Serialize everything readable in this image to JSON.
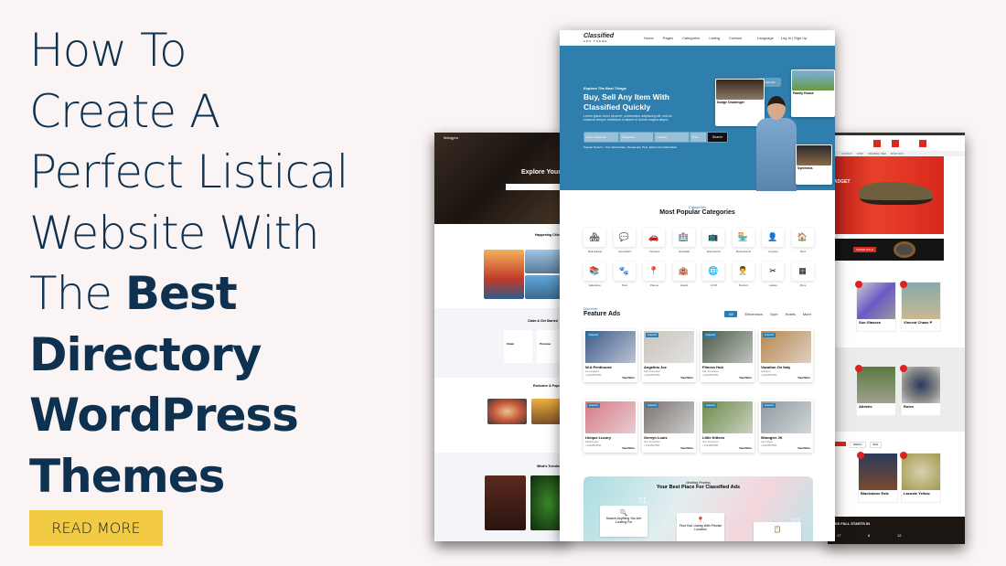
{
  "headline": {
    "lines_light": [
      "How To",
      "Create A",
      "Perfect Listical",
      "Website With"
    ],
    "line5_light": "The",
    "line5_bold": "Best",
    "lines_bold": [
      "Directory",
      "WordPress",
      "Themes"
    ]
  },
  "cta": {
    "label": "READ MORE",
    "color": "#f2ca43"
  },
  "colors": {
    "background": "#faf4f4",
    "headline": "#0e3150",
    "classified_blue": "#2f7fae",
    "shop_red": "#d9281e"
  },
  "left_mockup": {
    "logo": "listingpro",
    "hero_title": "Explore Your",
    "sections": [
      "Happening Cities",
      "Claim & Get Started",
      "Exclusive & Popular",
      "What's Trending"
    ],
    "claim_cards": [
      "Claim",
      "Promote"
    ]
  },
  "center_mockup": {
    "logo": "Classified",
    "logo_sub": "ADS THEME",
    "nav": [
      "Home",
      "Pages",
      "Categories",
      "Listing",
      "Contact"
    ],
    "nav_right": [
      "Language",
      "Log In | Sign Up"
    ],
    "hero": {
      "tag": "Explore The Best Things",
      "title": "Buy, Sell Any Item With Classified Quickly",
      "desc": "Lorem ipsum dolor sit amet, consectetur adipiscing elit, sed do eiusmod tempor incididunt ut labore et dolore magna aliqua.",
      "search_fields": [
        "Enter Keywords",
        "Categories",
        "Location",
        "Price"
      ],
      "search_button": "Search",
      "popular": "Popular Search :- Car, Real Estate, Restaurant, Pets, Electronics  #Allmodels",
      "ads_badge": "1200 Ads",
      "cards": [
        "Dodge Challenger",
        "Family House",
        "Synthesis"
      ]
    },
    "categories": {
      "tag": "Categories",
      "title": "Most Popular Categories",
      "items": [
        {
          "label": "Real Estate",
          "icon": "🏘"
        },
        {
          "label": "Consultant",
          "icon": "💬"
        },
        {
          "label": "Vehicles",
          "icon": "🚗"
        },
        {
          "label": "Hospitals",
          "icon": "🏥"
        },
        {
          "label": "Electronics",
          "icon": "📺"
        },
        {
          "label": "Restaurants",
          "icon": "🏪"
        },
        {
          "label": "Cupster",
          "icon": "👤"
        },
        {
          "label": "Rent",
          "icon": "🏠"
        },
        {
          "label": "Education",
          "icon": "📚"
        },
        {
          "label": "Pets",
          "icon": "🐾"
        },
        {
          "label": "Places",
          "icon": "📍"
        },
        {
          "label": "Hotels",
          "icon": "🏨"
        },
        {
          "label": "GYM",
          "icon": "🌐"
        },
        {
          "label": "Doctors",
          "icon": "👨‍⚕️"
        },
        {
          "label": "Ladies",
          "icon": "✂"
        },
        {
          "label": "More",
          "icon": "▦"
        }
      ]
    },
    "feature_ads": {
      "tag": "Discover",
      "title": "Feature Ads",
      "filters": [
        "All",
        "Electronics",
        "Gym",
        "Hotels",
        "More"
      ],
      "cards": [
        {
          "title": "W.A Penthouse",
          "location": "Los Angeles",
          "color": "#3d5a8a"
        },
        {
          "title": "Angelina Joe",
          "location": "San Francisco",
          "color": "#c8c4bd"
        },
        {
          "title": "Fitness Hub",
          "location": "San Francisco",
          "color": "#4b5a48"
        },
        {
          "title": "Vacation On Italy",
          "location": "Houston",
          "color": "#b7864f"
        },
        {
          "title": "Unique Luxury",
          "location": "Washington",
          "color": "#d67a86"
        },
        {
          "title": "Gervyn Louis",
          "location": "San Francisco",
          "color": "#7a7470"
        },
        {
          "title": "Little Kittens",
          "location": "San Francisco",
          "color": "#6d8a4a"
        },
        {
          "title": "Wrangler JK",
          "location": "Las Vegas",
          "color": "#8e9aa0"
        }
      ],
      "phone": "+1234567890",
      "view_label": "View More",
      "badge": "Featured"
    },
    "process": {
      "tag": "Working Process",
      "title": "Your Best Place For Classified Ads",
      "steps": [
        "Search Anything You Are Looking For",
        "Find Your Listing With Precise Location"
      ],
      "numbers": [
        "01",
        "03"
      ]
    }
  },
  "right_mockup": {
    "banner_title": "GADGET",
    "sale_label": "SUPER SALE",
    "nav": [
      "CONTACT",
      "SHOP",
      "TRENDING ITEM",
      "SHOP NOW"
    ],
    "products": [
      "Sun Glasses",
      "Vincent Chase P",
      "Athletic",
      "Rolex",
      "Blackstone Eslk",
      "Lacoste Yellow"
    ],
    "tabs": [
      "Watches",
      "Belts"
    ],
    "countdown_title": "THIS FALL STARTS IN",
    "countdown": [
      "17",
      "8",
      "12"
    ]
  }
}
